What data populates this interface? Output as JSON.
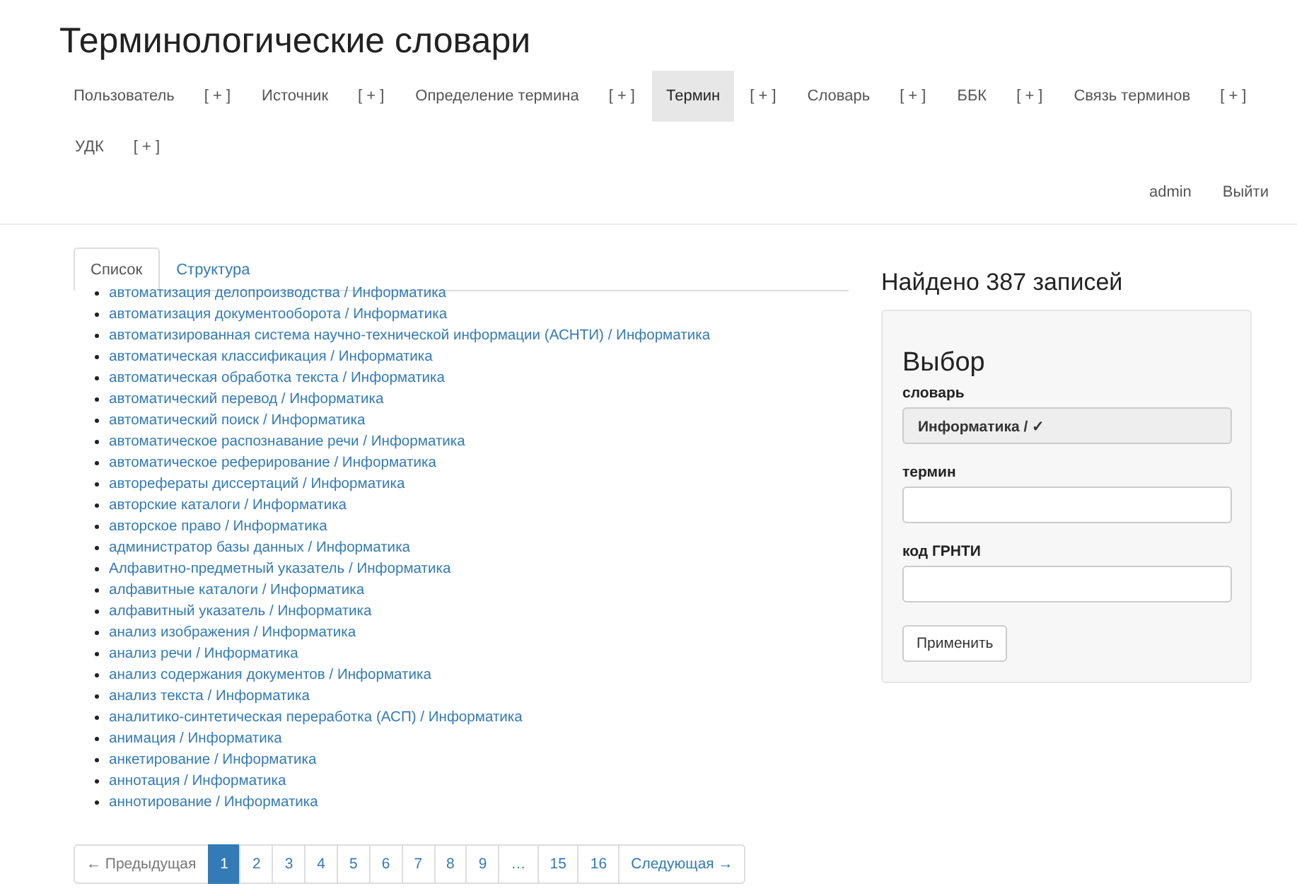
{
  "page_title": "Терминологические словари",
  "nav": [
    {
      "label": "Пользователь",
      "add": "[ + ]",
      "selected": false
    },
    {
      "label": "Источник",
      "add": "[ + ]",
      "selected": false
    },
    {
      "label": "Определение термина",
      "add": "[ + ]",
      "selected": false
    },
    {
      "label": "Термин",
      "add": "[ + ]",
      "selected": true
    },
    {
      "label": "Словарь",
      "add": "[ + ]",
      "selected": false
    },
    {
      "label": "ББК",
      "add": "[ + ]",
      "selected": false
    },
    {
      "label": "Связь терминов",
      "add": "[ + ]",
      "selected": false
    },
    {
      "label": "УДК",
      "add": "[ + ]",
      "selected": false
    }
  ],
  "user_nav": [
    "admin",
    "Выйти"
  ],
  "tabs": [
    {
      "label": "Список",
      "selected": true
    },
    {
      "label": "Структура",
      "selected": false
    }
  ],
  "terms": [
    "автоматизация делопроизводства / Информатика",
    "автоматизация документооборота / Информатика",
    "автоматизированная система научно-технической информации (АСНТИ) / Информатика",
    "автоматическая классификация / Информатика",
    "автоматическая обработка текста / Информатика",
    "автоматический перевод / Информатика",
    "автоматический поиск / Информатика",
    "автоматическое распознавание речи / Информатика",
    "автоматическое реферирование / Информатика",
    "авторефераты диссертаций / Информатика",
    "авторские каталоги / Информатика",
    "авторское право / Информатика",
    "администратор базы данных / Информатика",
    "Алфавитно-предметный указатель / Информатика",
    "алфавитные каталоги / Информатика",
    "алфавитный указатель / Информатика",
    "анализ изображения / Информатика",
    "анализ речи / Информатика",
    "анализ содержания документов / Информатика",
    "анализ текста / Информатика",
    "аналитико-синтетическая переработка (АСП) / Информатика",
    "анимация / Информатика",
    "анкетирование / Информатика",
    "аннотация / Информатика",
    "аннотирование / Информатика"
  ],
  "pagination": [
    {
      "label": "← Предыдущая",
      "selected": false
    },
    {
      "label": "1",
      "selected": true
    },
    {
      "label": "2",
      "selected": false
    },
    {
      "label": "3",
      "selected": false
    },
    {
      "label": "4",
      "selected": false
    },
    {
      "label": "5",
      "selected": false
    },
    {
      "label": "6",
      "selected": false
    },
    {
      "label": "7",
      "selected": false
    },
    {
      "label": "8",
      "selected": false
    },
    {
      "label": "9",
      "selected": false
    },
    {
      "label": "…",
      "selected": false
    },
    {
      "label": "15",
      "selected": false
    },
    {
      "label": "16",
      "selected": false
    },
    {
      "label": "Следующая →",
      "selected": false
    }
  ],
  "result_count": "Найдено 387 записей",
  "filter": {
    "title": "Выбор",
    "fields": [
      {
        "kind": "select",
        "label": "словарь",
        "value": "Информатика / ✓"
      },
      {
        "kind": "text",
        "label": "термин"
      },
      {
        "kind": "text",
        "label": "код ГРНТИ"
      }
    ],
    "button": "Применить"
  }
}
